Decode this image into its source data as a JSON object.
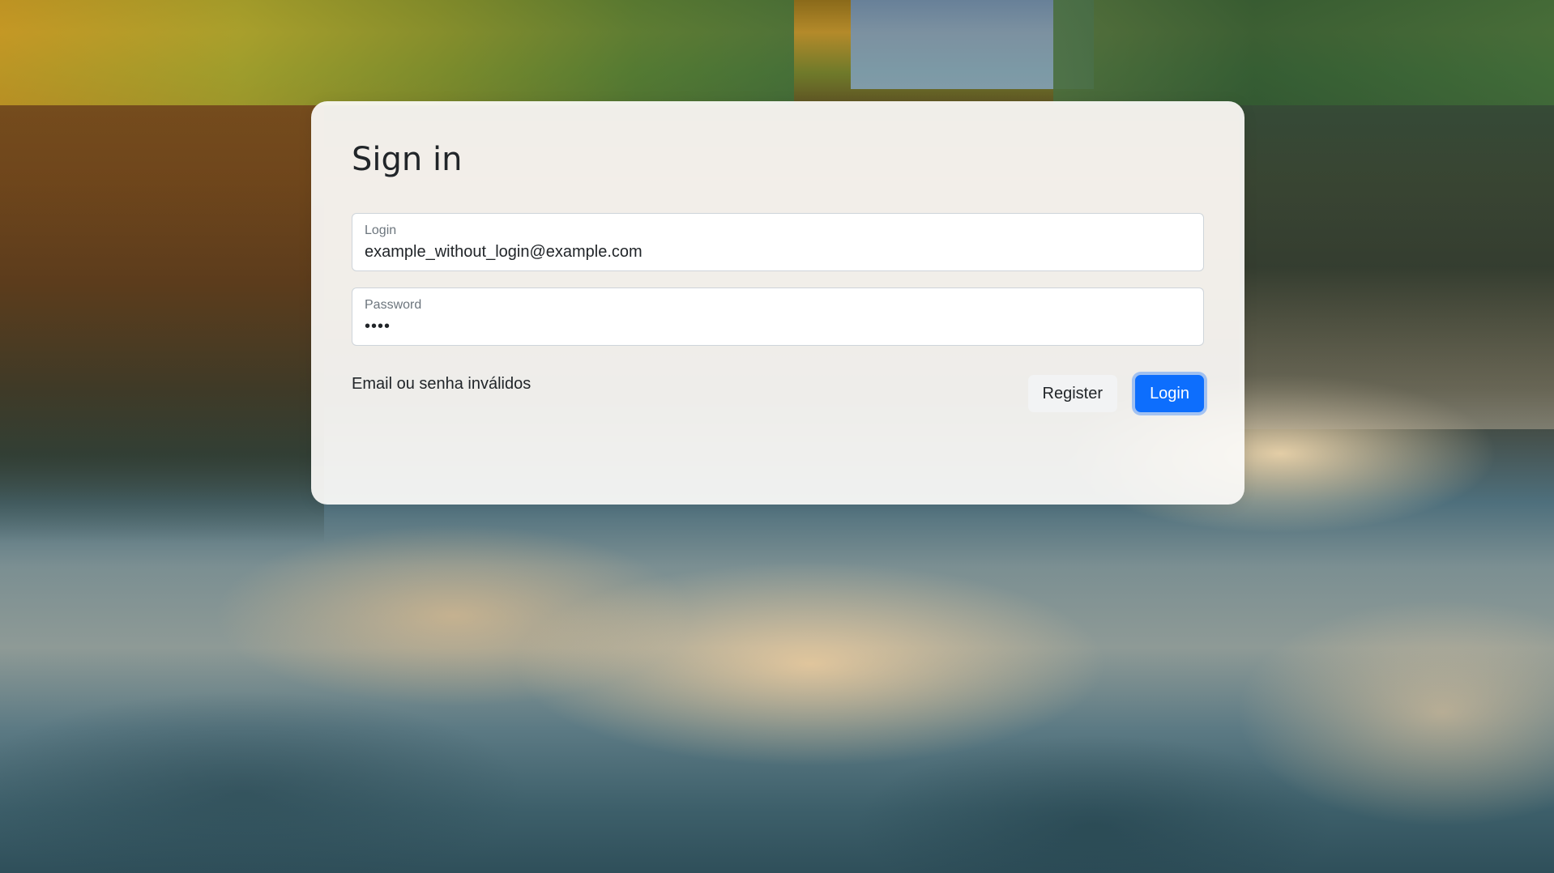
{
  "page": {
    "title": "Sign in"
  },
  "form": {
    "login": {
      "label": "Login",
      "value": "example_without_login@example.com"
    },
    "password": {
      "label": "Password",
      "value": "••••"
    },
    "error_message": "Email ou senha inválidos",
    "register_label": "Register",
    "login_label": "Login"
  },
  "colors": {
    "primary": "#0d6efd",
    "card_background": "#fcfbf9",
    "text": "#212529",
    "label": "#6c757d"
  }
}
